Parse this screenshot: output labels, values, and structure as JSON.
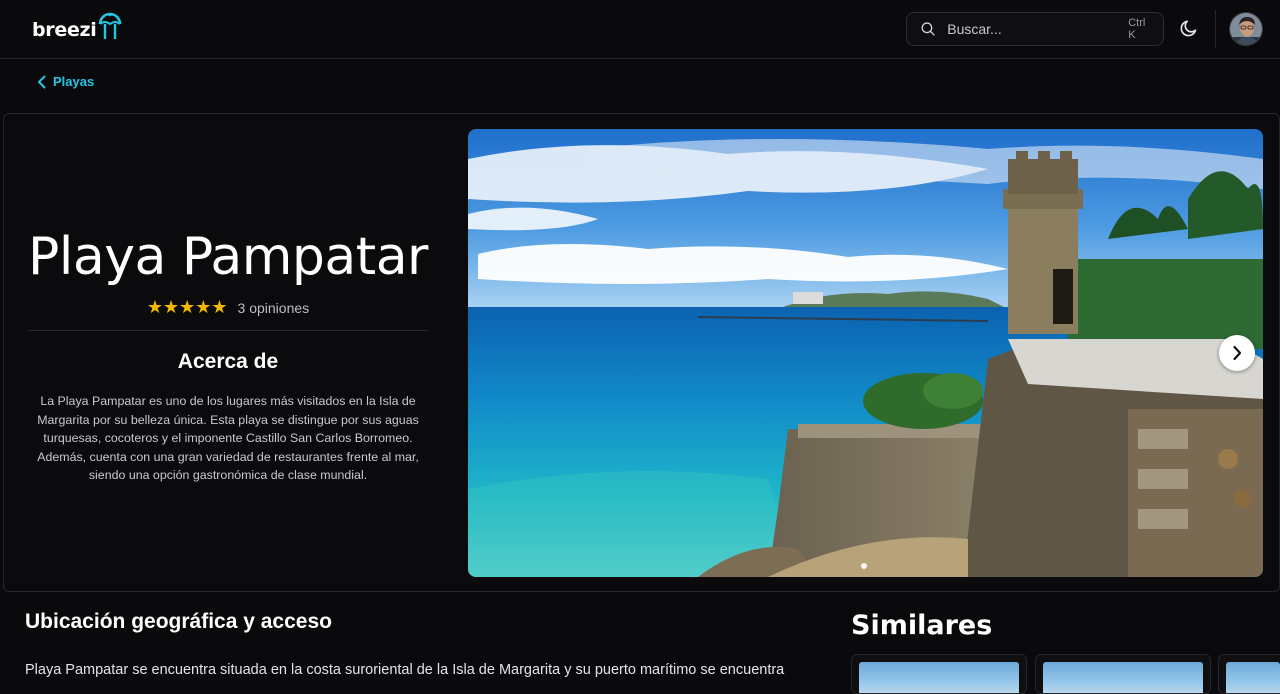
{
  "app": {
    "logo_text": "breezi",
    "brand_color": "#22c7e6"
  },
  "header": {
    "search": {
      "placeholder": "Buscar...",
      "shortcut": "Ctrl K",
      "icon": "search-icon"
    },
    "theme_toggle_icon": "moon-icon",
    "avatar_icon": "user-avatar"
  },
  "breadcrumb": {
    "back_label": "Playas",
    "icon": "chevron-left-icon"
  },
  "place": {
    "title": "Playa Pampatar",
    "stars": "★★★★★",
    "rating_value": 5,
    "reviews_label": "3 opiniones",
    "about_title": "Acerca de",
    "about_text": "La Playa Pampatar es uno de los lugares más visitados en la Isla de Margarita por su belleza única. Esta playa se distingue por sus aguas turquesas, cocoteros y el imponente Castillo San Carlos Borromeo. Además, cuenta con una gran variedad de restaurantes frente al mar, siendo una opción gastronómica de clase mundial."
  },
  "gallery": {
    "next_icon": "chevron-right-icon",
    "slide_count": 1,
    "active_slide": 1
  },
  "location": {
    "title": "Ubicación geográfica y acceso",
    "text": "Playa Pampatar se encuentra situada en la costa suroriental de la Isla de Margarita y su puerto marítimo se encuentra"
  },
  "similar": {
    "title": "Similares"
  }
}
